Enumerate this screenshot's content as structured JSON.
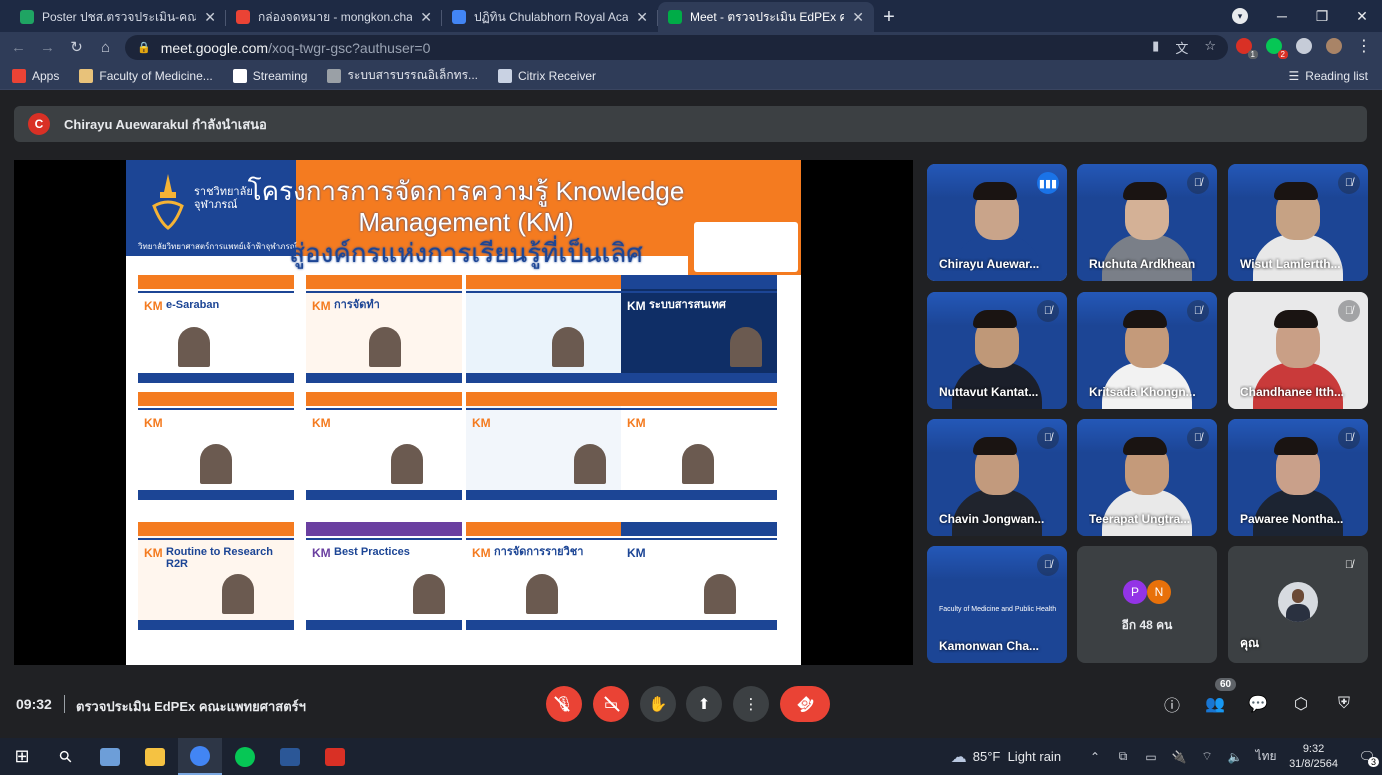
{
  "browser": {
    "tabs": [
      {
        "title": "Poster ปชส.ตรวจประเมิน-คณะแพทยศ",
        "favicon_color": "#1fa463",
        "active": false
      },
      {
        "title": "กล่องจดหมาย - mongkon.cha@cra",
        "favicon_color": "#ea4335",
        "active": false
      },
      {
        "title": "ปฏิทิน Chulabhorn Royal Academy",
        "favicon_color": "#4285f4",
        "active": false
      },
      {
        "title": "Meet - ตรวจประเมิน EdPEx คณ",
        "favicon_color": "#00ac47",
        "active": true
      }
    ],
    "close_glyph": "✕",
    "new_tab_glyph": "+",
    "window_controls": [
      "─",
      "❐",
      "✕"
    ],
    "nav": {
      "back": "←",
      "forward": "→",
      "reload": "↻",
      "home": "⌂"
    },
    "url_host": "meet.google.com",
    "url_path": "/xoq-twgr-gsc?authuser=0",
    "omnibox_icons": [
      "camera-icon",
      "translate-icon",
      "star-icon"
    ],
    "omnibox_glyphs": [
      "▮",
      "文",
      "☆"
    ],
    "extensions": [
      {
        "name": "extension-red-icon",
        "color": "#d93025",
        "badge": "1",
        "badge_color": "#5f6368"
      },
      {
        "name": "extension-line-icon",
        "color": "#06c755",
        "badge": "2",
        "badge_color": "#d93025"
      },
      {
        "name": "puzzle-icon",
        "color": "#c6ccd8",
        "badge": "",
        "badge_color": ""
      },
      {
        "name": "profile-avatar-icon",
        "color": "#a98467",
        "badge": "",
        "badge_color": ""
      }
    ],
    "menu_glyph": "⋮",
    "bookmarks": [
      {
        "label": "Apps",
        "color": "#ea4335"
      },
      {
        "label": "Faculty of Medicine...",
        "color": "#e8c27a"
      },
      {
        "label": "Streaming",
        "color": "#ffffff"
      },
      {
        "label": "ระบบสารบรรณอิเล็กทร...",
        "color": "#9aa0a6"
      },
      {
        "label": "Citrix Receiver",
        "color": "#c9d2e3"
      }
    ],
    "reading_list": "Reading list"
  },
  "meet": {
    "presenter_initial": "C",
    "presenter_text": "Chirayu Auewarakul กำลังนำเสนอ",
    "slide": {
      "title_line1": "โครงการการจัดการความรู้ Knowledge",
      "title_line2": "Management (KM)",
      "title_line3": "สู่องค์กรแห่งการเรียนรู้ที่เป็นเลิศ",
      "institution": "ราชวิทยาลัย\nจุฬาภรณ์",
      "institution_sub": "วิทยาลัยวิทยาศาสตร์การแพทย์เจ้าฟ้าจุฬาภรณ์",
      "thumbs": [
        {
          "km": "KM",
          "title": "e-Saraban",
          "accent": "#f47b20",
          "bg": "#ffffff"
        },
        {
          "km": "KM",
          "title": "การจัดทำ",
          "accent": "#f47b20",
          "bg": "#fff6ee"
        },
        {
          "km": "",
          "title": "",
          "accent": "#f47b20",
          "bg": "#eaf3fb"
        },
        {
          "km": "KM",
          "title": "ระบบสารสนเทศ",
          "accent": "#1c4595",
          "bg": "#0f2e66"
        },
        {
          "km": "KM",
          "title": "",
          "accent": "#f47b20",
          "bg": "#ffffff"
        },
        {
          "km": "KM",
          "title": "",
          "accent": "#f47b20",
          "bg": "#ffffff"
        },
        {
          "km": "KM",
          "title": "",
          "accent": "#f47b20",
          "bg": "#f2f6fb"
        },
        {
          "km": "KM",
          "title": "",
          "accent": "#f47b20",
          "bg": "#ffffff"
        },
        {
          "km": "KM",
          "title": "Routine to Research R2R",
          "accent": "#f47b20",
          "bg": "#fff6ee"
        },
        {
          "km": "KM",
          "title": "Best Practices",
          "accent": "#6a3fa0",
          "bg": "#ffffff"
        },
        {
          "km": "KM",
          "title": "การจัดการรายวิชา",
          "accent": "#f47b20",
          "bg": "#ffffff"
        },
        {
          "km": "KM",
          "title": "",
          "accent": "#1c4595",
          "bg": "#ffffff"
        }
      ]
    },
    "participants": [
      {
        "name": "Chirayu Auewar...",
        "mic": "speaking",
        "bg": "#1c4595",
        "skin": "#c9a48a",
        "shirt": "#1c4595",
        "active": true
      },
      {
        "name": "Ruchuta Ardkhean",
        "mic": "muted",
        "bg": "#1c4595",
        "skin": "#d4b196",
        "shirt": "#7a7f88",
        "active": false
      },
      {
        "name": "Wisut Lamlertth...",
        "mic": "muted",
        "bg": "#1c4595",
        "skin": "#c6a284",
        "shirt": "#e8e8e8",
        "active": false
      },
      {
        "name": "Nuttavut Kantat...",
        "mic": "muted",
        "bg": "#1c4595",
        "skin": "#bf9878",
        "shirt": "#1b1f2a",
        "active": false
      },
      {
        "name": "Kritsada Khongn...",
        "mic": "muted",
        "bg": "#1c4595",
        "skin": "#c49a7a",
        "shirt": "#f2f2f2",
        "active": false
      },
      {
        "name": "Chandhanee Itth...",
        "mic": "muted",
        "bg": "#e9e9ea",
        "skin": "#c99f86",
        "shirt": "#c93a3a",
        "active": false
      },
      {
        "name": "Chavin Jongwan...",
        "mic": "muted",
        "bg": "#1c4595",
        "skin": "#c29a7d",
        "shirt": "#20242d",
        "active": false
      },
      {
        "name": "Teerapat Ungtra...",
        "mic": "muted",
        "bg": "#1c4595",
        "skin": "#c49a7a",
        "shirt": "#e9e9e9",
        "active": false
      },
      {
        "name": "Pawaree Nontha...",
        "mic": "muted",
        "bg": "#1c4595",
        "skin": "#c9a08a",
        "shirt": "#1c2432",
        "active": false
      },
      {
        "name": "Kamonwan Cha...",
        "mic": "muted",
        "bg": "#1c4595",
        "skin": "",
        "shirt": "",
        "active": false
      }
    ],
    "tile_caption": "Faculty of Medicine and Public Health",
    "more_tile": {
      "label": "อีก 48 คน",
      "avatars": [
        {
          "letter": "P",
          "color": "#9334e6"
        },
        {
          "letter": "N",
          "color": "#e8710a"
        }
      ]
    },
    "self_tile": {
      "label": "คุณ"
    },
    "clock": "09:32",
    "meeting_title": "ตรวจประเมิน EdPEx คณะแพทยศาสตร์ฯ",
    "people_count": "60",
    "controls": {
      "mic": "🎙",
      "camera": "▭",
      "hand": "✋",
      "present": "⬆",
      "more": "⋮",
      "end": "☎"
    },
    "right_icons": {
      "info": "ⓘ",
      "people": "👥",
      "chat": "💬",
      "activities": "⬡",
      "host": "⛨"
    },
    "colors": {
      "danger": "#ea4335",
      "button_grey": "#3c4043",
      "active_outline": "#8ab4f8"
    }
  },
  "taskbar": {
    "start_glyph": "⊞",
    "search_glyph": "⚲",
    "apps": [
      {
        "name": "paint-app-icon",
        "color": "#6d9ed8",
        "active": false
      },
      {
        "name": "file-explorer-icon",
        "color": "#f5c242",
        "active": false
      },
      {
        "name": "chrome-app-icon",
        "color": "#4285f4",
        "active": true
      },
      {
        "name": "line-app-icon",
        "color": "#06c755",
        "active": false
      },
      {
        "name": "word-app-icon",
        "color": "#2b5797",
        "active": false
      },
      {
        "name": "camera-app-icon",
        "color": "#d93025",
        "active": false
      }
    ],
    "weather": "85°F  Light rain",
    "weather_glyph": "☁",
    "tray_glyphs": [
      "⌃",
      "⧉",
      "▭",
      "🔌",
      "⌔",
      "🔈"
    ],
    "language": "ไทย",
    "time": "9:32",
    "date": "31/8/2564",
    "notifications": "3"
  }
}
